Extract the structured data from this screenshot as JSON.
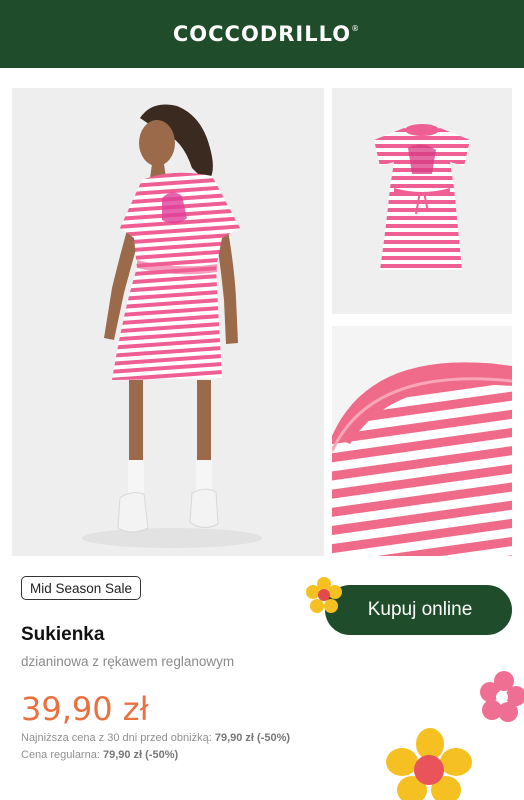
{
  "brand": {
    "logo": "COCCODRILLO",
    "reg_mark": "®"
  },
  "colors": {
    "header_bg": "#1f4d2b",
    "button_bg": "#1f4d2b",
    "price": "#e9703f",
    "stripe_pink": "#ef5f93"
  },
  "gallery": {
    "main_alt": "girl wearing pink striped dress",
    "top_alt": "pink striped dress product shot",
    "bottom_alt": "close-up of striped collar"
  },
  "badge": {
    "label": "Mid Season Sale"
  },
  "buy_button": {
    "label": "Kupuj online"
  },
  "product": {
    "title": "Sukienka",
    "subtitle": "dzianinowa z rękawem reglanowym",
    "price": "39,90 zł",
    "lowest_price_label": "Najniższa cena z 30 dni przed obniżką:",
    "lowest_price_value": "79,90 zł (-50%)",
    "regular_price_label": "Cena regularna:",
    "regular_price_value": "79,90 zł (-50%)"
  },
  "icons": [
    "yellow-flower-icon",
    "pink-flower-icon",
    "large-yellow-flower-icon"
  ]
}
